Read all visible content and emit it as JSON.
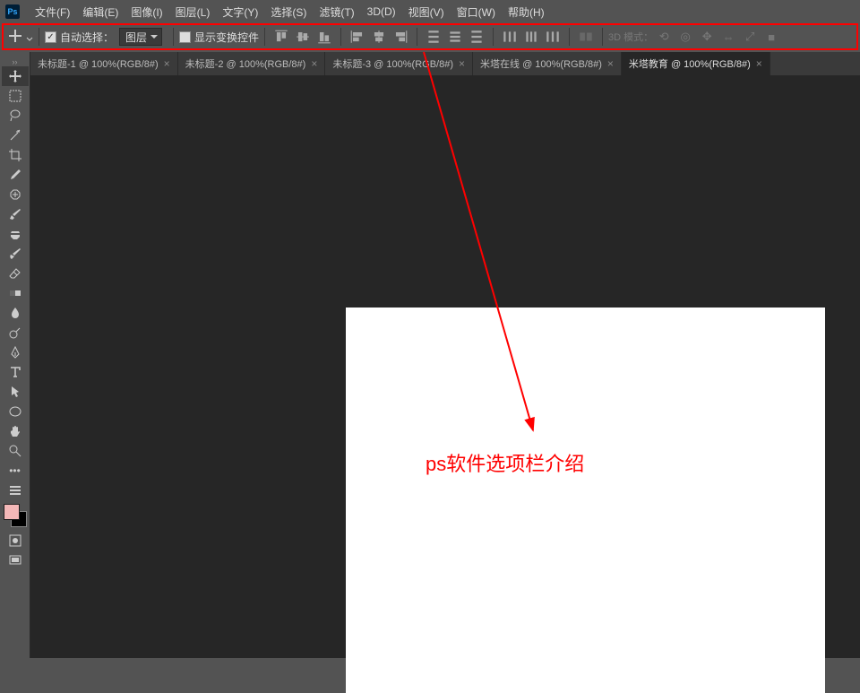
{
  "menu": {
    "items": [
      {
        "label": "文件(F)"
      },
      {
        "label": "编辑(E)"
      },
      {
        "label": "图像(I)"
      },
      {
        "label": "图层(L)"
      },
      {
        "label": "文字(Y)"
      },
      {
        "label": "选择(S)"
      },
      {
        "label": "滤镜(T)"
      },
      {
        "label": "3D(D)"
      },
      {
        "label": "视图(V)"
      },
      {
        "label": "窗口(W)"
      },
      {
        "label": "帮助(H)"
      }
    ]
  },
  "options": {
    "auto_select_label": "自动选择：",
    "auto_select_checked": true,
    "layer_dropdown": "图层",
    "show_transform_label": "显示变换控件",
    "show_transform_checked": false,
    "mode_3d_label": "3D 模式："
  },
  "tools": [
    {
      "name": "move-tool"
    },
    {
      "name": "marquee-tool"
    },
    {
      "name": "lasso-tool"
    },
    {
      "name": "magic-wand-tool"
    },
    {
      "name": "crop-tool"
    },
    {
      "name": "eyedropper-tool"
    },
    {
      "name": "spot-heal-tool"
    },
    {
      "name": "brush-tool"
    },
    {
      "name": "clone-stamp-tool"
    },
    {
      "name": "history-brush-tool"
    },
    {
      "name": "eraser-tool"
    },
    {
      "name": "gradient-tool"
    },
    {
      "name": "blur-tool"
    },
    {
      "name": "dodge-tool"
    },
    {
      "name": "pen-tool"
    },
    {
      "name": "text-tool"
    },
    {
      "name": "path-select-tool"
    },
    {
      "name": "shape-tool"
    },
    {
      "name": "hand-tool"
    },
    {
      "name": "zoom-tool"
    }
  ],
  "bottom_tools": [
    {
      "name": "edit-toolbar-tool"
    },
    {
      "name": "quick-mask-tool"
    },
    {
      "name": "screen-mode-tool"
    }
  ],
  "swatch": {
    "fg": "#f4b8b8",
    "bg": "#000000"
  },
  "tabs": [
    {
      "label": "未标题-1 @ 100%(RGB/8#)",
      "active": false
    },
    {
      "label": "未标题-2 @ 100%(RGB/8#)",
      "active": false
    },
    {
      "label": "未标题-3 @ 100%(RGB/8#)",
      "active": false
    },
    {
      "label": "米塔在线 @ 100%(RGB/8#)",
      "active": false
    },
    {
      "label": "米塔教育 @ 100%(RGB/8#)",
      "active": true
    }
  ],
  "annotation": {
    "text": "ps软件选项栏介绍",
    "color": "red"
  }
}
